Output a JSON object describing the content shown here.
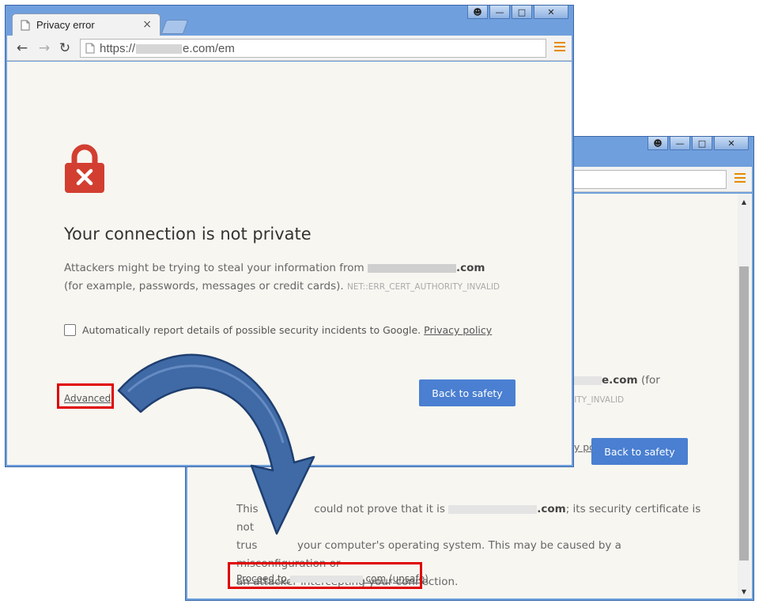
{
  "front_window": {
    "tab_title": "Privacy error",
    "url_prefix": "https://",
    "url_suffix": "e.com/em",
    "window_controls": [
      "user-icon",
      "minimize-icon",
      "maximize-icon",
      "close-icon"
    ],
    "heading": "Your connection is not private",
    "para_part1": "Attackers might be trying to steal your information from",
    "para_domain_suffix": ".com",
    "para_part2": "(for example, passwords, messages or credit cards).",
    "error_code": "NET::ERR_CERT_AUTHORITY_INVALID",
    "checkbox_label": "Automatically report details of possible security incidents to Google.",
    "privacy_link": "Privacy policy",
    "advanced_link": "Advanced",
    "back_button": "Back to safety"
  },
  "back_window": {
    "partial_domain": "e.com",
    "partial_for": "(for",
    "partial_errcode": "RITY_INVALID",
    "partial_policy": "cy policy",
    "back_button": "Back to safety",
    "detail_p1": "This",
    "detail_p2": "could not prove that it is",
    "detail_domain": ".com",
    "detail_p3": "; its security certificate is not",
    "detail_line2a": "trus",
    "detail_line2b": "your computer's operating system. This may be caused by a misconfiguration or",
    "detail_line3": "an attacker intercepting your connection.",
    "proceed_prefix": "Proceed to",
    "proceed_suffix": ".com (unsafe)"
  },
  "colors": {
    "accent_blue": "#4a7fd1",
    "highlight_red": "#e00000",
    "lock_red": "#d23f31",
    "arrow_blue": "#3f6aa6"
  }
}
